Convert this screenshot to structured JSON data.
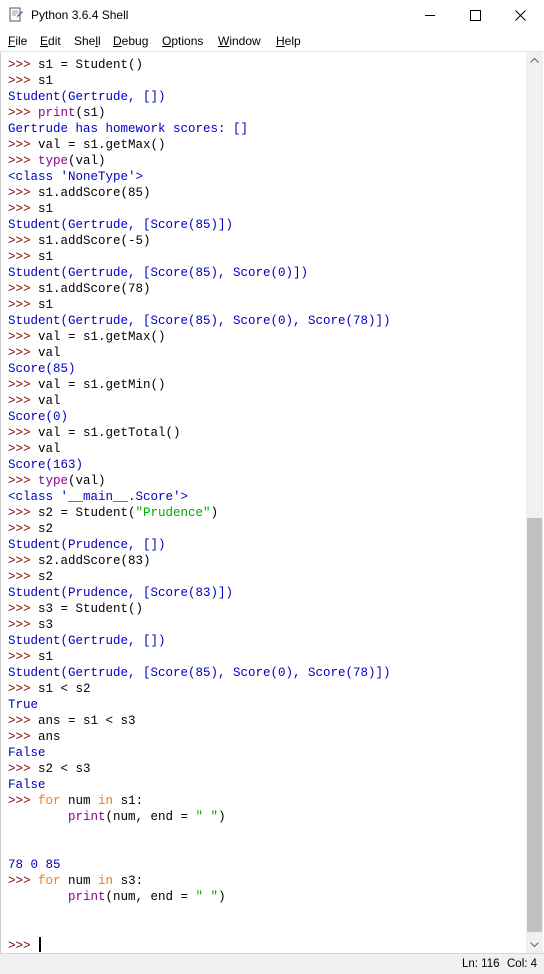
{
  "window": {
    "title": "Python 3.6.4 Shell",
    "icons": {
      "app": "python-idle-icon",
      "minimize": "minimize-icon",
      "maximize": "maximize-icon",
      "close": "close-icon"
    }
  },
  "menu": [
    {
      "u": "F",
      "rest": "ile"
    },
    {
      "u": "E",
      "rest": "dit"
    },
    {
      "pre": "She",
      "u": "l",
      "rest": "l"
    },
    {
      "u": "D",
      "rest": "ebug"
    },
    {
      "u": "O",
      "rest": "ptions"
    },
    {
      "u": "W",
      "rest": "indow"
    },
    {
      "u": "H",
      "rest": "elp"
    }
  ],
  "shell_lines": [
    [
      {
        "t": ">>> ",
        "c": "prompt"
      },
      {
        "t": "s1 = Student()",
        "c": "code"
      }
    ],
    [
      {
        "t": ">>> ",
        "c": "prompt"
      },
      {
        "t": "s1",
        "c": "code"
      }
    ],
    [
      {
        "t": "Student(Gertrude, [])",
        "c": "out"
      }
    ],
    [
      {
        "t": ">>> ",
        "c": "prompt"
      },
      {
        "t": "print",
        "c": "builtin"
      },
      {
        "t": "(s1)",
        "c": "code"
      }
    ],
    [
      {
        "t": "Gertrude has homework scores: []",
        "c": "out"
      }
    ],
    [
      {
        "t": ">>> ",
        "c": "prompt"
      },
      {
        "t": "val = s1.getMax()",
        "c": "code"
      }
    ],
    [
      {
        "t": ">>> ",
        "c": "prompt"
      },
      {
        "t": "type",
        "c": "builtin"
      },
      {
        "t": "(val)",
        "c": "code"
      }
    ],
    [
      {
        "t": "<class 'NoneType'>",
        "c": "out"
      }
    ],
    [
      {
        "t": ">>> ",
        "c": "prompt"
      },
      {
        "t": "s1.addScore(85)",
        "c": "code"
      }
    ],
    [
      {
        "t": ">>> ",
        "c": "prompt"
      },
      {
        "t": "s1",
        "c": "code"
      }
    ],
    [
      {
        "t": "Student(Gertrude, [Score(85)])",
        "c": "out"
      }
    ],
    [
      {
        "t": ">>> ",
        "c": "prompt"
      },
      {
        "t": "s1.addScore(-5)",
        "c": "code"
      }
    ],
    [
      {
        "t": ">>> ",
        "c": "prompt"
      },
      {
        "t": "s1",
        "c": "code"
      }
    ],
    [
      {
        "t": "Student(Gertrude, [Score(85), Score(0)])",
        "c": "out"
      }
    ],
    [
      {
        "t": ">>> ",
        "c": "prompt"
      },
      {
        "t": "s1.addScore(78)",
        "c": "code"
      }
    ],
    [
      {
        "t": ">>> ",
        "c": "prompt"
      },
      {
        "t": "s1",
        "c": "code"
      }
    ],
    [
      {
        "t": "Student(Gertrude, [Score(85), Score(0), Score(78)])",
        "c": "out"
      }
    ],
    [
      {
        "t": ">>> ",
        "c": "prompt"
      },
      {
        "t": "val = s1.getMax()",
        "c": "code"
      }
    ],
    [
      {
        "t": ">>> ",
        "c": "prompt"
      },
      {
        "t": "val",
        "c": "code"
      }
    ],
    [
      {
        "t": "Score(85)",
        "c": "out"
      }
    ],
    [
      {
        "t": ">>> ",
        "c": "prompt"
      },
      {
        "t": "val = s1.getMin()",
        "c": "code"
      }
    ],
    [
      {
        "t": ">>> ",
        "c": "prompt"
      },
      {
        "t": "val",
        "c": "code"
      }
    ],
    [
      {
        "t": "Score(0)",
        "c": "out"
      }
    ],
    [
      {
        "t": ">>> ",
        "c": "prompt"
      },
      {
        "t": "val = s1.getTotal()",
        "c": "code"
      }
    ],
    [
      {
        "t": ">>> ",
        "c": "prompt"
      },
      {
        "t": "val",
        "c": "code"
      }
    ],
    [
      {
        "t": "Score(163)",
        "c": "out"
      }
    ],
    [
      {
        "t": ">>> ",
        "c": "prompt"
      },
      {
        "t": "type",
        "c": "builtin"
      },
      {
        "t": "(val)",
        "c": "code"
      }
    ],
    [
      {
        "t": "<class '__main__.Score'>",
        "c": "out"
      }
    ],
    [
      {
        "t": ">>> ",
        "c": "prompt"
      },
      {
        "t": "s2 = Student(",
        "c": "code"
      },
      {
        "t": "\"Prudence\"",
        "c": "str"
      },
      {
        "t": ")",
        "c": "code"
      }
    ],
    [
      {
        "t": ">>> ",
        "c": "prompt"
      },
      {
        "t": "s2",
        "c": "code"
      }
    ],
    [
      {
        "t": "Student(Prudence, [])",
        "c": "out"
      }
    ],
    [
      {
        "t": ">>> ",
        "c": "prompt"
      },
      {
        "t": "s2.addScore(83)",
        "c": "code"
      }
    ],
    [
      {
        "t": ">>> ",
        "c": "prompt"
      },
      {
        "t": "s2",
        "c": "code"
      }
    ],
    [
      {
        "t": "Student(Prudence, [Score(83)])",
        "c": "out"
      }
    ],
    [
      {
        "t": ">>> ",
        "c": "prompt"
      },
      {
        "t": "s3 = Student()",
        "c": "code"
      }
    ],
    [
      {
        "t": ">>> ",
        "c": "prompt"
      },
      {
        "t": "s3",
        "c": "code"
      }
    ],
    [
      {
        "t": "Student(Gertrude, [])",
        "c": "out"
      }
    ],
    [
      {
        "t": ">>> ",
        "c": "prompt"
      },
      {
        "t": "s1",
        "c": "code"
      }
    ],
    [
      {
        "t": "Student(Gertrude, [Score(85), Score(0), Score(78)])",
        "c": "out"
      }
    ],
    [
      {
        "t": ">>> ",
        "c": "prompt"
      },
      {
        "t": "s1 < s2",
        "c": "code"
      }
    ],
    [
      {
        "t": "True",
        "c": "out"
      }
    ],
    [
      {
        "t": ">>> ",
        "c": "prompt"
      },
      {
        "t": "ans = s1 < s3",
        "c": "code"
      }
    ],
    [
      {
        "t": ">>> ",
        "c": "prompt"
      },
      {
        "t": "ans",
        "c": "code"
      }
    ],
    [
      {
        "t": "False",
        "c": "out"
      }
    ],
    [
      {
        "t": ">>> ",
        "c": "prompt"
      },
      {
        "t": "s2 < s3",
        "c": "code"
      }
    ],
    [
      {
        "t": "False",
        "c": "out"
      }
    ],
    [
      {
        "t": ">>> ",
        "c": "prompt"
      },
      {
        "t": "for",
        "c": "kw"
      },
      {
        "t": " num ",
        "c": "code"
      },
      {
        "t": "in",
        "c": "kw"
      },
      {
        "t": " s1:",
        "c": "code"
      }
    ],
    [
      {
        "t": "        ",
        "c": "code"
      },
      {
        "t": "print",
        "c": "builtin"
      },
      {
        "t": "(num, end = ",
        "c": "code"
      },
      {
        "t": "\" \"",
        "c": "str"
      },
      {
        "t": ")",
        "c": "code"
      }
    ],
    [],
    [],
    [
      {
        "t": "78 0 85",
        "c": "out"
      }
    ],
    [
      {
        "t": ">>> ",
        "c": "prompt"
      },
      {
        "t": "for",
        "c": "kw"
      },
      {
        "t": " num ",
        "c": "code"
      },
      {
        "t": "in",
        "c": "kw"
      },
      {
        "t": " s3:",
        "c": "code"
      }
    ],
    [
      {
        "t": "        ",
        "c": "code"
      },
      {
        "t": "print",
        "c": "builtin"
      },
      {
        "t": "(num, end = ",
        "c": "code"
      },
      {
        "t": "\" \"",
        "c": "str"
      },
      {
        "t": ")",
        "c": "code"
      }
    ],
    [],
    [],
    [
      {
        "t": ">>> ",
        "c": "prompt"
      }
    ]
  ],
  "status": {
    "line": "Ln: 116",
    "col": "Col: 4"
  },
  "scrollbar": {
    "up_icon": "scroll-up-icon",
    "down_icon": "scroll-down-icon"
  },
  "colors": {
    "prompt": "#7f0000",
    "output": "#0000c0",
    "keyword": "#ff7700",
    "builtin": "#900090",
    "string": "#00aa00"
  }
}
